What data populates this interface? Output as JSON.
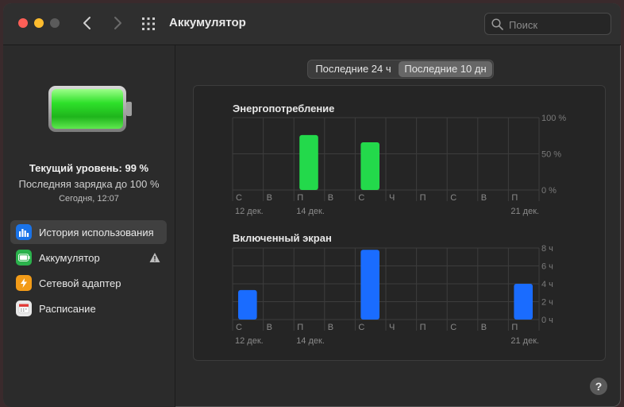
{
  "window": {
    "title": "Аккумулятор"
  },
  "search": {
    "placeholder": "Поиск"
  },
  "sidebar": {
    "current_level": "Текущий уровень: 99 %",
    "last_charge": "Последняя зарядка до 100 %",
    "time": "Сегодня, 12:07",
    "items": [
      {
        "label": "История использования",
        "icon": "bar-chart-icon",
        "color": "#1a73e8",
        "active": true
      },
      {
        "label": "Аккумулятор",
        "icon": "battery-icon",
        "color": "#2bb24c",
        "warning": true
      },
      {
        "label": "Сетевой адаптер",
        "icon": "lightning-icon",
        "color": "#f29b18"
      },
      {
        "label": "Расписание",
        "icon": "calendar-icon",
        "color": "#e8e8e8"
      }
    ]
  },
  "segmented": {
    "option_a": "Последние 24 ч",
    "option_b": "Последние 10 дн",
    "selected": "option_b"
  },
  "help_label": "?",
  "chart_data": [
    {
      "type": "bar",
      "title": "Энергопотребление",
      "categories": [
        "С",
        "В",
        "П",
        "В",
        "С",
        "Ч",
        "П",
        "С",
        "В",
        "П"
      ],
      "date_labels": [
        "12 дек.",
        "",
        "14 дек.",
        "",
        "",
        "",
        "",
        "",
        "",
        "21 дек."
      ],
      "values": [
        0,
        0,
        76,
        0,
        66,
        0,
        0,
        0,
        0,
        0
      ],
      "yticks": [
        "100 %",
        "50 %",
        "0 %"
      ],
      "ylim": [
        0,
        100
      ],
      "color": "#23d94b",
      "grid": true
    },
    {
      "type": "bar",
      "title": "Включенный экран",
      "categories": [
        "С",
        "В",
        "П",
        "В",
        "С",
        "Ч",
        "П",
        "С",
        "В",
        "П"
      ],
      "date_labels": [
        "12 дек.",
        "",
        "14 дек.",
        "",
        "",
        "",
        "",
        "",
        "",
        "21 дек."
      ],
      "values": [
        3.3,
        0,
        0,
        0,
        7.8,
        0,
        0,
        0,
        0,
        4.0
      ],
      "yticks": [
        "8 ч",
        "6 ч",
        "4 ч",
        "2 ч",
        "0 ч"
      ],
      "ylim": [
        0,
        8
      ],
      "color": "#1a6cff",
      "grid": true
    }
  ]
}
